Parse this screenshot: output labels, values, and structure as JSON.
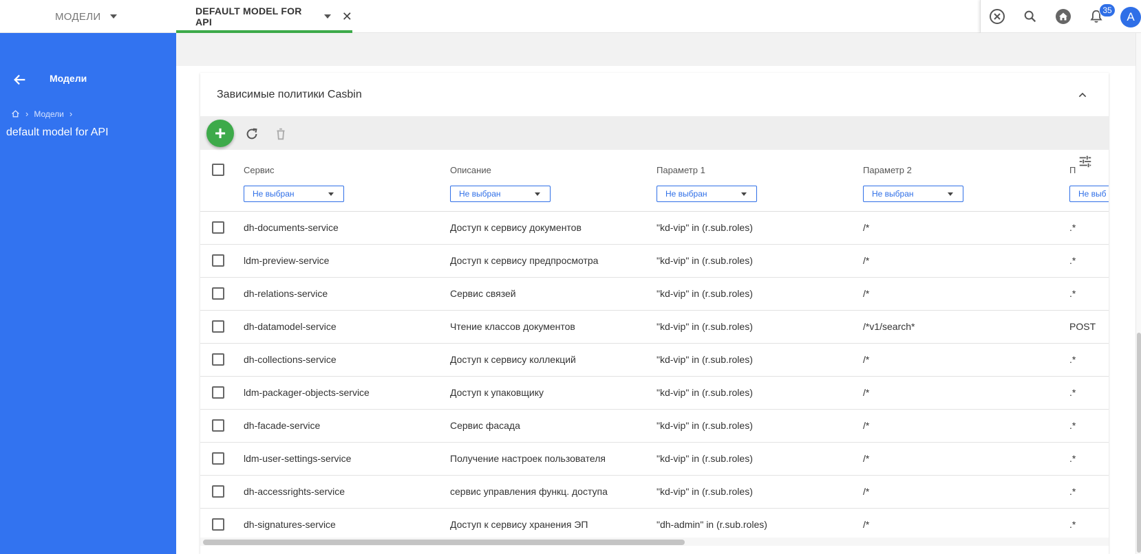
{
  "topbar": {
    "tab_models": "МОДЕЛИ",
    "tab_active": "DEFAULT MODEL FOR API",
    "notification_count": "35",
    "avatar_letter": "A"
  },
  "sidebar": {
    "title": "Модели",
    "breadcrumb": [
      "Модели"
    ],
    "model_name": "default model for API"
  },
  "card": {
    "title": "Зависимые политики Casbin"
  },
  "table": {
    "columns": [
      {
        "label": "Сервис",
        "filter": "Не выбран"
      },
      {
        "label": "Описание",
        "filter": "Не выбран"
      },
      {
        "label": "Параметр 1",
        "filter": "Не выбран"
      },
      {
        "label": "Параметр 2",
        "filter": "Не выбран"
      },
      {
        "label": "П",
        "filter": "Не выб"
      }
    ],
    "rows": [
      {
        "service": "dh-documents-service",
        "desc": "Доступ к сервису документов",
        "p1": "\"kd-vip\" in (r.sub.roles)",
        "p2": "/*",
        "p3": ".*"
      },
      {
        "service": "ldm-preview-service",
        "desc": "Доступ к сервису предпросмотра",
        "p1": "\"kd-vip\" in (r.sub.roles)",
        "p2": "/*",
        "p3": ".*"
      },
      {
        "service": "dh-relations-service",
        "desc": "Сервис связей",
        "p1": "\"kd-vip\" in (r.sub.roles)",
        "p2": "/*",
        "p3": ".*"
      },
      {
        "service": "dh-datamodel-service",
        "desc": "Чтение классов документов",
        "p1": "\"kd-vip\" in (r.sub.roles)",
        "p2": "/*v1/search*",
        "p3": "POST"
      },
      {
        "service": "dh-collections-service",
        "desc": "Доступ к сервису коллекций",
        "p1": "\"kd-vip\" in (r.sub.roles)",
        "p2": "/*",
        "p3": ".*"
      },
      {
        "service": "ldm-packager-objects-service",
        "desc": "Доступ к упаковщику",
        "p1": "\"kd-vip\" in (r.sub.roles)",
        "p2": "/*",
        "p3": ".*"
      },
      {
        "service": "dh-facade-service",
        "desc": "Сервис фасада",
        "p1": "\"kd-vip\" in (r.sub.roles)",
        "p2": "/*",
        "p3": ".*"
      },
      {
        "service": "ldm-user-settings-service",
        "desc": "Получение настроек пользователя",
        "p1": "\"kd-vip\" in (r.sub.roles)",
        "p2": "/*",
        "p3": ".*"
      },
      {
        "service": "dh-accessrights-service",
        "desc": "сервис управления функц. доступа",
        "p1": "\"kd-vip\" in (r.sub.roles)",
        "p2": "/*",
        "p3": ".*"
      },
      {
        "service": "dh-signatures-service",
        "desc": "Доступ к сервису хранения ЭП",
        "p1": "\"dh-admin\" in (r.sub.roles)",
        "p2": "/*",
        "p3": ".*"
      }
    ]
  },
  "colors": {
    "sidebar": "#3273f0",
    "accent_green": "#3daa4a",
    "accent_blue": "#2f6fe7"
  },
  "icons": [
    "arrow-back-icon",
    "home-icon",
    "chevron-right-icon",
    "chevron-up-icon",
    "plus-icon",
    "refresh-icon",
    "trash-icon",
    "tune-icon",
    "close-circle-icon",
    "search-icon",
    "home-circle-icon",
    "bell-icon"
  ]
}
